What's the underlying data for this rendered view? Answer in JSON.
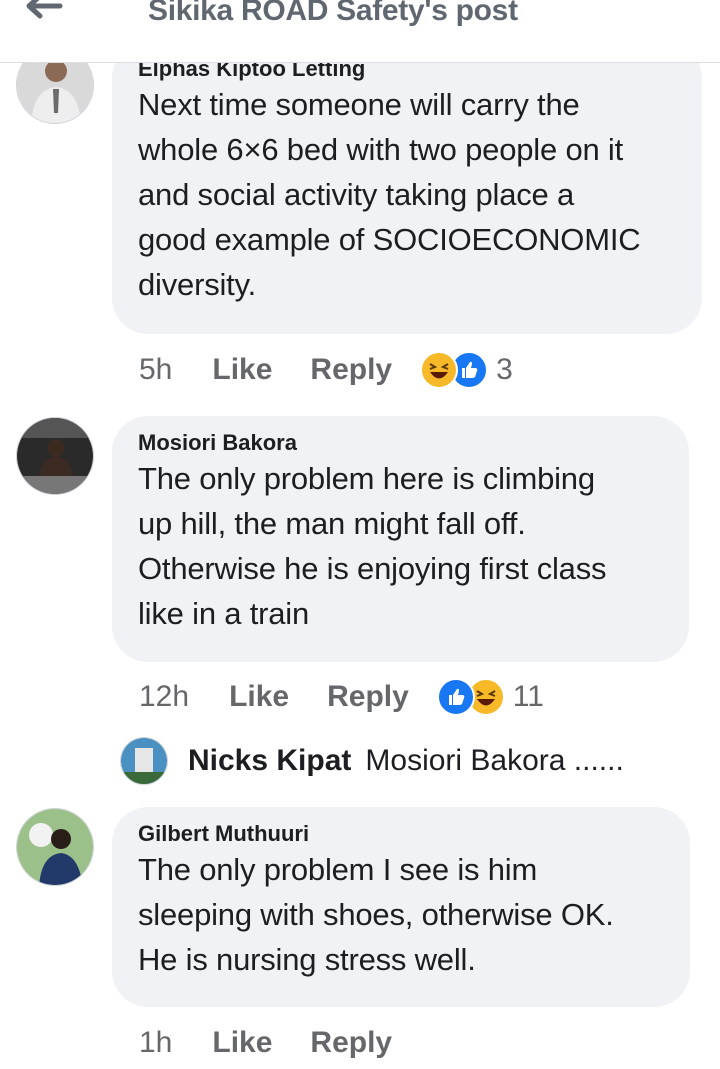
{
  "header": {
    "title": "Sikika ROAD Safety's post",
    "back_icon": "arrow-left-icon"
  },
  "comments": [
    {
      "author": "Elphas Kiptoo Letting",
      "lines": [
        "Next time someone will carry the",
        "whole 6×6 bed with two people on it",
        "and social activity taking place a",
        "good example of SOCIOECONOMIC",
        "diversity."
      ],
      "time": "5h",
      "like_label": "Like",
      "reply_label": "Reply",
      "reactions": [
        "haha",
        "like"
      ],
      "reaction_count": "3"
    },
    {
      "author": "Mosiori Bakora",
      "lines": [
        "The only problem here is climbing",
        "up hill, the man might fall off.",
        "Otherwise he is enjoying first class",
        "like in a train"
      ],
      "time": "12h",
      "like_label": "Like",
      "reply_label": "Reply",
      "reactions": [
        "like",
        "haha"
      ],
      "reaction_count": "11"
    },
    {
      "author": "Gilbert Muthuuri",
      "lines": [
        "The only problem I see is him",
        "sleeping with shoes, otherwise OK.",
        "He is nursing stress well."
      ],
      "time": "1h",
      "like_label": "Like",
      "reply_label": "Reply"
    }
  ],
  "reply_preview": {
    "author": "Nicks Kipat",
    "text": "Mosiori Bakora ......"
  },
  "colors": {
    "bubble": "#f0f2f5",
    "secondary_text": "#65676b",
    "like_blue": "#1877f2",
    "haha_yellow": "#f7b928"
  }
}
